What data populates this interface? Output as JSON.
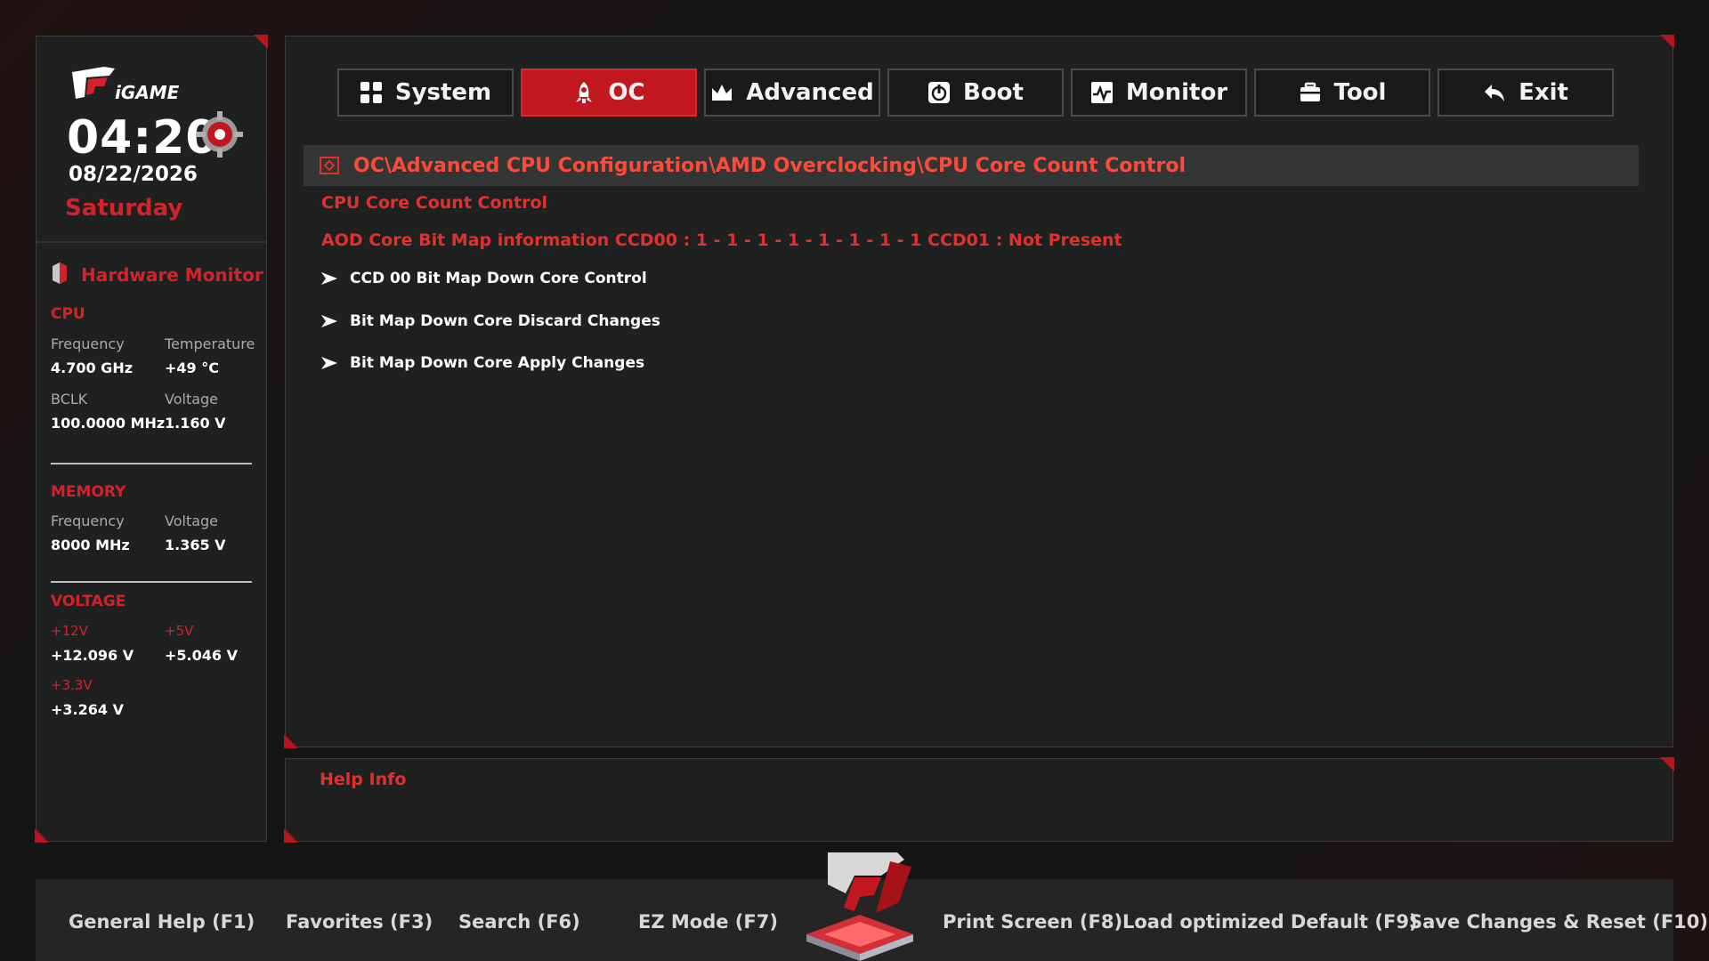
{
  "header": {
    "clock": "04:20",
    "date": "08/22/2026",
    "day": "Saturday"
  },
  "hardware_monitor": {
    "title": "Hardware Monitor",
    "cpu": {
      "section": "CPU",
      "frequency_label": "Frequency",
      "frequency_value": "4.700 GHz",
      "temperature_label": "Temperature",
      "temperature_value": "+49 °C",
      "bclk_label": "BCLK",
      "bclk_value": "100.0000 MHz",
      "voltage_label": "Voltage",
      "voltage_value": "1.160 V"
    },
    "memory": {
      "section": "MEMORY",
      "frequency_label": "Frequency",
      "frequency_value": "8000 MHz",
      "voltage_label": "Voltage",
      "voltage_value": "1.365 V"
    },
    "voltage": {
      "section": "VOLTAGE",
      "v12_label": "+12V",
      "v12_value": "+12.096 V",
      "v5_label": "+5V",
      "v5_value": "+5.046 V",
      "v33_label": "+3.3V",
      "v33_value": "+3.264 V"
    }
  },
  "tabs": [
    {
      "label": "System",
      "icon": "grid-icon",
      "active": false
    },
    {
      "label": "OC",
      "icon": "rocket-icon",
      "active": true
    },
    {
      "label": "Advanced",
      "icon": "crown-icon",
      "active": false
    },
    {
      "label": "Boot",
      "icon": "power-icon",
      "active": false
    },
    {
      "label": "Monitor",
      "icon": "pulse-icon",
      "active": false
    },
    {
      "label": "Tool",
      "icon": "toolbox-icon",
      "active": false
    },
    {
      "label": "Exit",
      "icon": "exit-arrow-icon",
      "active": false
    }
  ],
  "main": {
    "breadcrumb": "OC\\Advanced CPU Configuration\\AMD Overclocking\\CPU Core Count Control",
    "page_title": "CPU Core Count Control",
    "aod_info": "AOD Core Bit Map information CCD00 : 1 - 1 - 1 - 1 - 1 - 1 - 1 - 1  CCD01 : Not Present",
    "items": [
      {
        "label": "CCD 00 Bit Map Down Core Control"
      },
      {
        "label": "Bit Map Down Core Discard Changes"
      },
      {
        "label": "Bit Map Down Core Apply Changes"
      }
    ]
  },
  "help": {
    "title": "Help Info"
  },
  "footer": {
    "general_help": "General Help (F1)",
    "favorites": "Favorites (F3)",
    "search": "Search (F6)",
    "ez_mode": "EZ Mode (F7)",
    "print_screen": "Print Screen (F8)",
    "load_default": "Load optimized Default (F9)",
    "save_reset": "Save Changes & Reset (F10)"
  },
  "colors": {
    "accent": "#d3232a",
    "active_tab": "#c0181e",
    "breadcrumb_text": "#ff4a3a"
  }
}
